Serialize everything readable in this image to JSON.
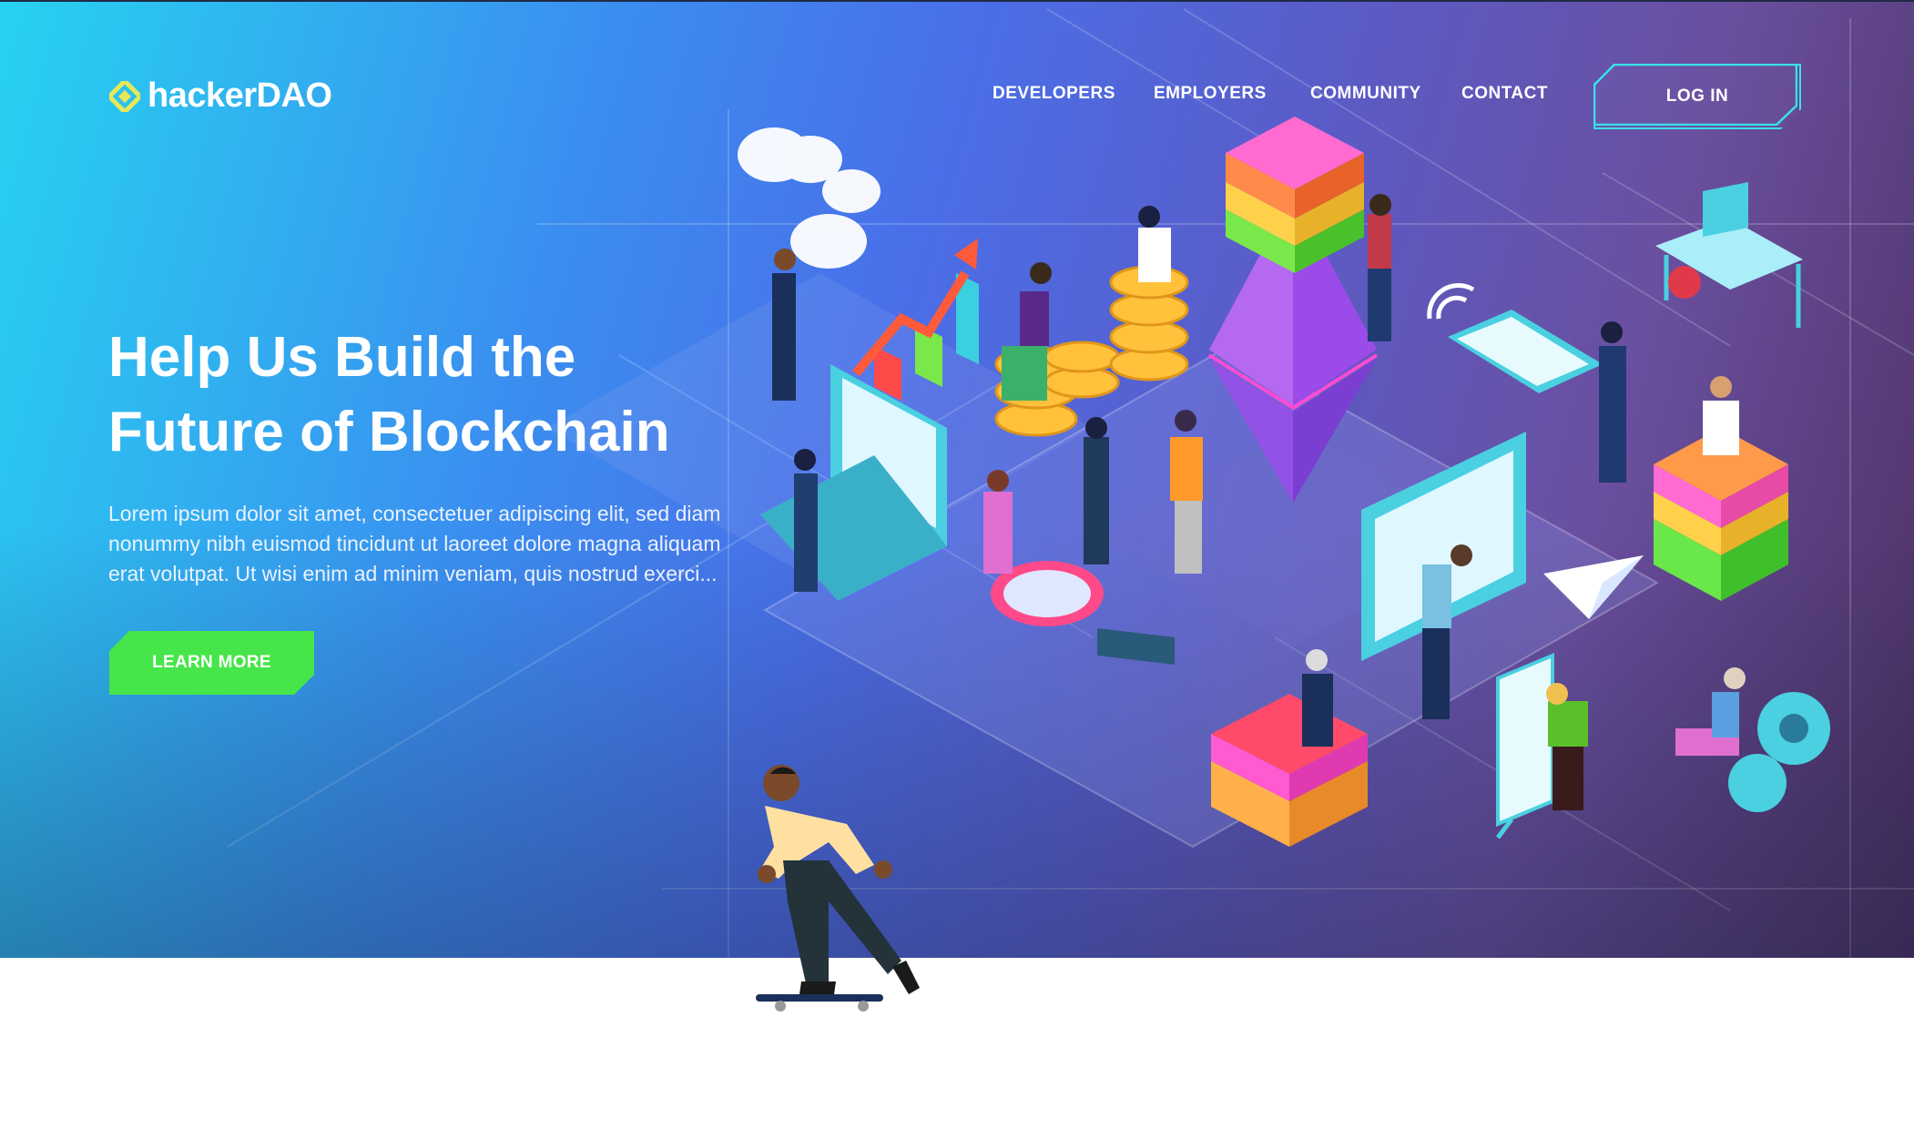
{
  "brand": {
    "name_prefix": "hacker",
    "name_suffix": "DAO",
    "icon": "hexagon-diamond-logo-icon",
    "logo_color": "#e6e85a"
  },
  "nav": {
    "items": [
      {
        "label": "DEVELOPERS"
      },
      {
        "label": "EMPLOYERS"
      },
      {
        "label": "COMMUNITY"
      },
      {
        "label": "CONTACT"
      }
    ],
    "login_label": "LOG IN"
  },
  "hero": {
    "title_line1": "Help Us Build the",
    "title_line2": "Future of Blockchain",
    "description": "Lorem ipsum dolor sit amet, consectetuer adipiscing elit, sed diam nonummy nibh euismod tincidunt ut laoreet dolore magna aliquam erat volutpat. Ut wisi enim ad minim veniam, quis nostrud exerci...",
    "cta_label": "LEARN MORE"
  },
  "colors": {
    "accent_green": "#46e64a",
    "accent_cyan": "#3ae0e8",
    "gradient_start": "#27d2f0",
    "gradient_end": "#4a2f5f"
  },
  "illustration": {
    "icon": "isometric-blockchain-illustration-icon"
  }
}
